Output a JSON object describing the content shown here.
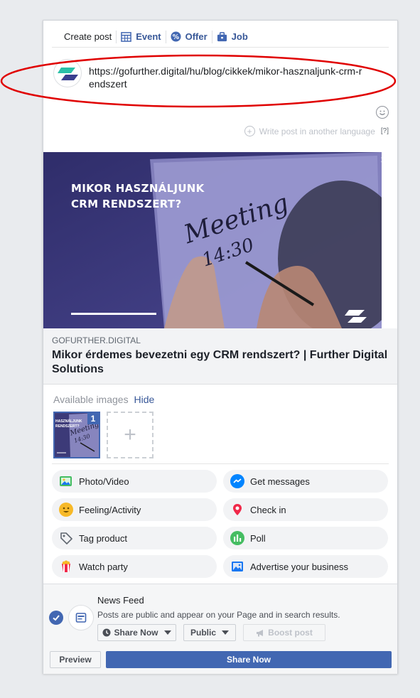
{
  "tabs": {
    "create_post": "Create post",
    "event": "Event",
    "offer": "Offer",
    "job": "Job"
  },
  "composer": {
    "url": "https://gofurther.digital/hu/blog/cikkek/mikor-hasznaljunk-crm-rendszert",
    "write_another_language": "Write post in another language",
    "help": "[?]"
  },
  "link_preview": {
    "image_title_line1": "MIKOR HASZNÁLJUNK",
    "image_title_line2": "CRM RENDSZERT?",
    "image_handwriting_1": "Meeting",
    "image_handwriting_2": "14:30",
    "close": "×",
    "domain": "GOFURTHER.DIGITAL",
    "title": "Mikor érdemes bevezetni egy CRM rendszert? | Further Digital Solutions"
  },
  "images": {
    "label": "Available images",
    "hide": "Hide",
    "thumb_badge": "1",
    "thumb_line1": "HASZNÁLJUNK",
    "thumb_line2": "RENDSZERT?",
    "add": "+"
  },
  "actions": [
    {
      "label": "Photo/Video",
      "icon": "photo-video-icon",
      "color": "#45bd62"
    },
    {
      "label": "Get messages",
      "icon": "messenger-icon",
      "color": "#0084ff"
    },
    {
      "label": "Feeling/Activity",
      "icon": "feeling-icon",
      "color": "#f7b928"
    },
    {
      "label": "Check in",
      "icon": "check-in-icon",
      "color": "#f02849"
    },
    {
      "label": "Tag product",
      "icon": "tag-icon",
      "color": "#90949c"
    },
    {
      "label": "Poll",
      "icon": "poll-icon",
      "color": "#45bd62"
    },
    {
      "label": "Watch party",
      "icon": "watch-party-icon",
      "color": "#f02849"
    },
    {
      "label": "Advertise your business",
      "icon": "advertise-icon",
      "color": "#1877f2"
    }
  ],
  "news_feed": {
    "title": "News Feed",
    "description": "Posts are public and appear on your Page and in search results.",
    "share_now_dropdown": "Share Now",
    "audience": "Public",
    "boost": "Boost post"
  },
  "footer": {
    "preview": "Preview",
    "share_now": "Share Now"
  },
  "colors": {
    "brand": "#4267b2",
    "link": "#385898",
    "annotation": "#e00000"
  }
}
